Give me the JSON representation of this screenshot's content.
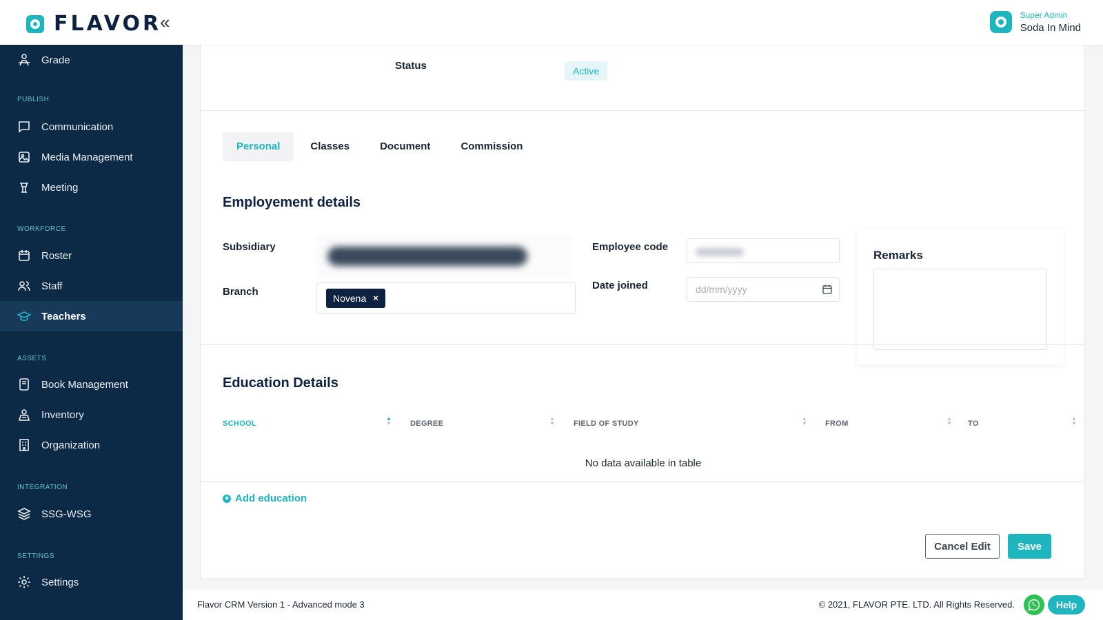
{
  "header": {
    "logo_text": "FLAVOR",
    "collapse_glyph": "«",
    "user_role": "Super Admin",
    "user_name": "Soda In Mind"
  },
  "sidebar": {
    "sections": {
      "publish": "PUBLISH",
      "workforce": "WORKFORCE",
      "assets": "ASSETS",
      "integration": "INTEGRATION",
      "settings": "SETTINGS"
    },
    "items": [
      {
        "label": "Grade",
        "icon": "grade-icon"
      },
      {
        "label": "Communication",
        "icon": "chat-icon"
      },
      {
        "label": "Media Management",
        "icon": "image-icon"
      },
      {
        "label": "Meeting",
        "icon": "podium-icon"
      },
      {
        "label": "Roster",
        "icon": "calendar-icon"
      },
      {
        "label": "Staff",
        "icon": "users-icon"
      },
      {
        "label": "Teachers",
        "icon": "graduation-cap-icon",
        "active": true
      },
      {
        "label": "Book Management",
        "icon": "book-icon"
      },
      {
        "label": "Inventory",
        "icon": "inventory-icon"
      },
      {
        "label": "Organization",
        "icon": "building-icon"
      },
      {
        "label": "SSG-WSG",
        "icon": "layers-icon"
      },
      {
        "label": "Settings",
        "icon": "gear-icon"
      }
    ]
  },
  "profile": {
    "status_label": "Status",
    "status_value": "Active"
  },
  "tabs": [
    "Personal",
    "Classes",
    "Document",
    "Commission"
  ],
  "employment": {
    "title": "Employement details",
    "subsidiary_label": "Subsidiary",
    "branch_label": "Branch",
    "branch_chip": "Novena",
    "chip_remove": "×",
    "employee_code_label": "Employee code",
    "date_joined_label": "Date joined",
    "date_placeholder": "dd/mm/yyyy",
    "remarks_label": "Remarks"
  },
  "education": {
    "title": "Education Details",
    "columns": [
      "SCHOOL",
      "DEGREE",
      "FIELD OF STUDY",
      "FROM",
      "TO"
    ],
    "empty_text": "No data available in table",
    "add_label": "Add education"
  },
  "actions": {
    "cancel": "Cancel Edit",
    "save": "Save"
  },
  "footer": {
    "version": "Flavor CRM Version 1 - Advanced mode 3",
    "copyright": "© 2021, FLAVOR PTE. LTD. All Rights Reserved.",
    "help": "Help"
  },
  "colors": {
    "accent": "#1fb5bf",
    "sidebar": "#0c2a46",
    "primary_text": "#0d2240"
  }
}
